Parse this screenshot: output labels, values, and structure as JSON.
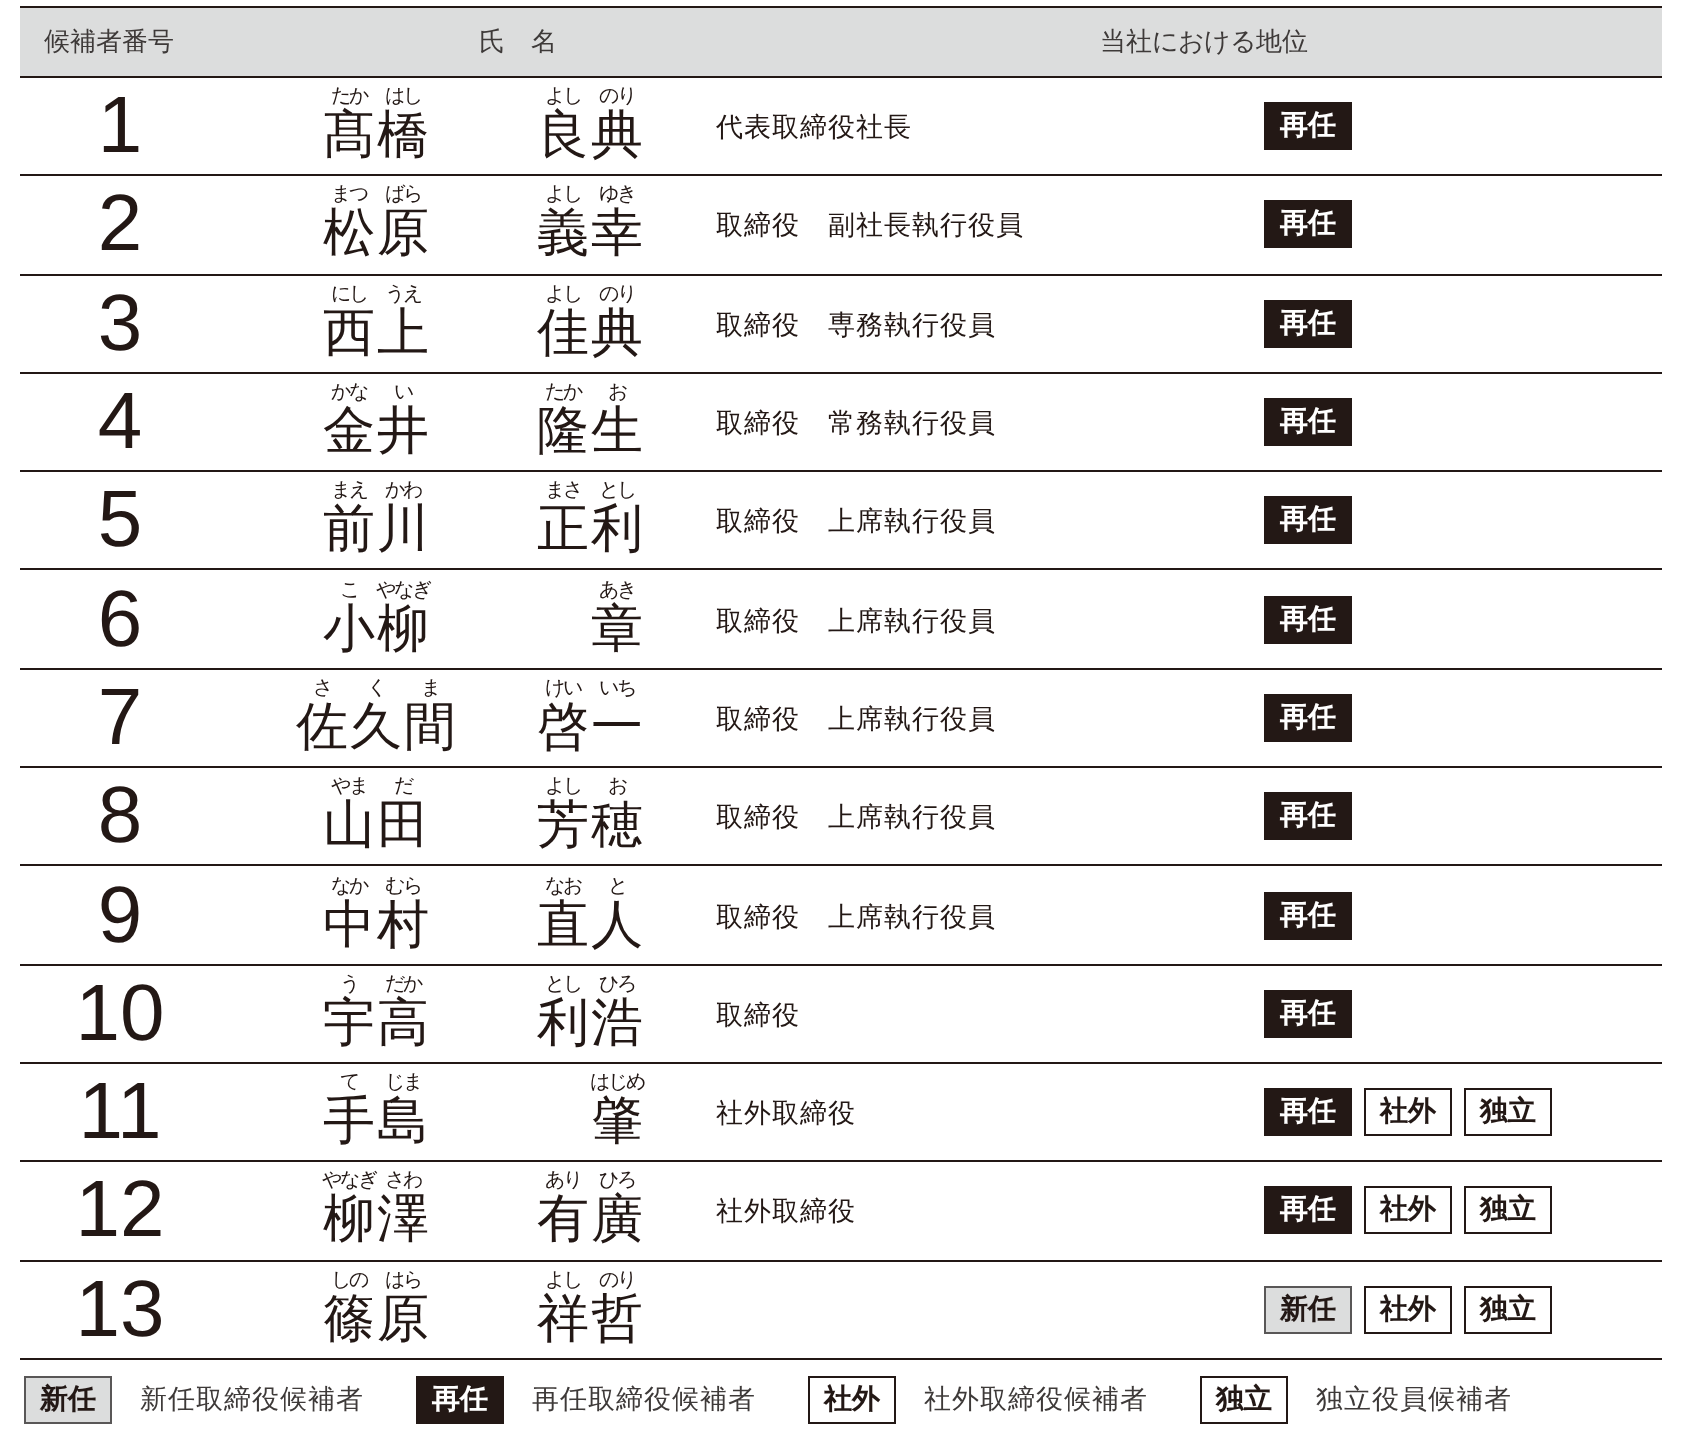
{
  "table": {
    "columns": [
      "候補者番号",
      "氏　名",
      "当社における地位"
    ],
    "rows": [
      {
        "number": "1",
        "family": [
          {
            "k": "髙",
            "r": "たか"
          },
          {
            "k": "橋",
            "r": "はし"
          }
        ],
        "given": [
          {
            "k": "良",
            "r": "よし"
          },
          {
            "k": "典",
            "r": "のり"
          }
        ],
        "position": "代表取締役社長",
        "tags": [
          {
            "kind": "reappoint",
            "label": "再任"
          }
        ]
      },
      {
        "number": "2",
        "family": [
          {
            "k": "松",
            "r": "まつ"
          },
          {
            "k": "原",
            "r": "ばら"
          }
        ],
        "given": [
          {
            "k": "義",
            "r": "よし"
          },
          {
            "k": "幸",
            "r": "ゆき"
          }
        ],
        "position": "取締役　副社長執行役員",
        "tags": [
          {
            "kind": "reappoint",
            "label": "再任"
          }
        ]
      },
      {
        "number": "3",
        "family": [
          {
            "k": "西",
            "r": "にし"
          },
          {
            "k": "上",
            "r": "うえ"
          }
        ],
        "given": [
          {
            "k": "佳",
            "r": "よし"
          },
          {
            "k": "典",
            "r": "のり"
          }
        ],
        "position": "取締役　専務執行役員",
        "tags": [
          {
            "kind": "reappoint",
            "label": "再任"
          }
        ]
      },
      {
        "number": "4",
        "family": [
          {
            "k": "金",
            "r": "かな"
          },
          {
            "k": "井",
            "r": "い"
          }
        ],
        "given": [
          {
            "k": "隆",
            "r": "たか"
          },
          {
            "k": "生",
            "r": "お"
          }
        ],
        "position": "取締役　常務執行役員",
        "tags": [
          {
            "kind": "reappoint",
            "label": "再任"
          }
        ]
      },
      {
        "number": "5",
        "family": [
          {
            "k": "前",
            "r": "まえ"
          },
          {
            "k": "川",
            "r": "かわ"
          }
        ],
        "given": [
          {
            "k": "正",
            "r": "まさ"
          },
          {
            "k": "利",
            "r": "とし"
          }
        ],
        "position": "取締役　上席執行役員",
        "tags": [
          {
            "kind": "reappoint",
            "label": "再任"
          }
        ]
      },
      {
        "number": "6",
        "family": [
          {
            "k": "小",
            "r": "こ"
          },
          {
            "k": "柳",
            "r": "やなぎ"
          }
        ],
        "given": [
          {
            "k": "章",
            "r": "あき"
          }
        ],
        "position": "取締役　上席執行役員",
        "tags": [
          {
            "kind": "reappoint",
            "label": "再任"
          }
        ]
      },
      {
        "number": "7",
        "family": [
          {
            "k": "佐",
            "r": "さ"
          },
          {
            "k": "久",
            "r": "く"
          },
          {
            "k": "間",
            "r": "ま"
          }
        ],
        "given": [
          {
            "k": "啓",
            "r": "けい"
          },
          {
            "k": "一",
            "r": "いち"
          }
        ],
        "position": "取締役　上席執行役員",
        "tags": [
          {
            "kind": "reappoint",
            "label": "再任"
          }
        ]
      },
      {
        "number": "8",
        "family": [
          {
            "k": "山",
            "r": "やま"
          },
          {
            "k": "田",
            "r": "だ"
          }
        ],
        "given": [
          {
            "k": "芳",
            "r": "よし"
          },
          {
            "k": "穂",
            "r": "お"
          }
        ],
        "position": "取締役　上席執行役員",
        "tags": [
          {
            "kind": "reappoint",
            "label": "再任"
          }
        ]
      },
      {
        "number": "9",
        "family": [
          {
            "k": "中",
            "r": "なか"
          },
          {
            "k": "村",
            "r": "むら"
          }
        ],
        "given": [
          {
            "k": "直",
            "r": "なお"
          },
          {
            "k": "人",
            "r": "と"
          }
        ],
        "position": "取締役　上席執行役員",
        "tags": [
          {
            "kind": "reappoint",
            "label": "再任"
          }
        ]
      },
      {
        "number": "10",
        "family": [
          {
            "k": "宇",
            "r": "う"
          },
          {
            "k": "高",
            "r": "だか"
          }
        ],
        "given": [
          {
            "k": "利",
            "r": "とし"
          },
          {
            "k": "浩",
            "r": "ひろ"
          }
        ],
        "position": "取締役",
        "tags": [
          {
            "kind": "reappoint",
            "label": "再任"
          }
        ]
      },
      {
        "number": "11",
        "family": [
          {
            "k": "手",
            "r": "て"
          },
          {
            "k": "島",
            "r": "じま"
          }
        ],
        "given": [
          {
            "k": "肇",
            "r": "はじめ"
          }
        ],
        "position": "社外取締役",
        "tags": [
          {
            "kind": "reappoint",
            "label": "再任"
          },
          {
            "kind": "outside",
            "label": "社外"
          },
          {
            "kind": "independent",
            "label": "独立"
          }
        ]
      },
      {
        "number": "12",
        "family": [
          {
            "k": "柳",
            "r": "やなぎ"
          },
          {
            "k": "澤",
            "r": "さわ"
          }
        ],
        "given": [
          {
            "k": "有",
            "r": "あり"
          },
          {
            "k": "廣",
            "r": "ひろ"
          }
        ],
        "position": "社外取締役",
        "tags": [
          {
            "kind": "reappoint",
            "label": "再任"
          },
          {
            "kind": "outside",
            "label": "社外"
          },
          {
            "kind": "independent",
            "label": "独立"
          }
        ]
      },
      {
        "number": "13",
        "family": [
          {
            "k": "篠",
            "r": "しの"
          },
          {
            "k": "原",
            "r": "はら"
          }
        ],
        "given": [
          {
            "k": "祥",
            "r": "よし"
          },
          {
            "k": "哲",
            "r": "のり"
          }
        ],
        "tags": [
          {
            "kind": "new",
            "label": "新任"
          },
          {
            "kind": "outside",
            "label": "社外"
          },
          {
            "kind": "independent",
            "label": "独立"
          }
        ]
      }
    ]
  },
  "legend": [
    {
      "kind": "new",
      "label": "新任",
      "text": "新任取締役候補者"
    },
    {
      "kind": "reappoint",
      "label": "再任",
      "text": "再任取締役候補者"
    },
    {
      "kind": "outside",
      "label": "社外",
      "text": "社外取締役候補者"
    },
    {
      "kind": "independent",
      "label": "独立",
      "text": "独立役員候補者"
    }
  ]
}
